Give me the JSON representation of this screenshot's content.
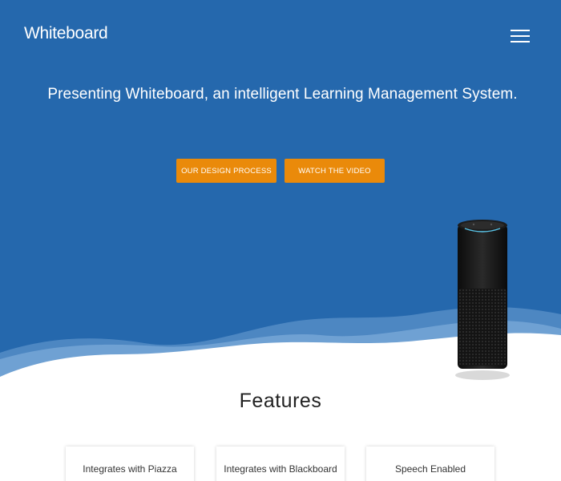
{
  "header": {
    "logo_text": "Whiteboard",
    "menu_icon": "hamburger-menu-icon"
  },
  "hero": {
    "tagline": "Presenting Whiteboard, an intelligent Learning Management System.",
    "buttons": {
      "design_process": "OUR DESIGN PROCESS",
      "watch_video": "WATCH THE VIDEO"
    },
    "device_image": "smart-speaker"
  },
  "features": {
    "title": "Features",
    "cards": [
      {
        "label": "Integrates with Piazza"
      },
      {
        "label": "Integrates with Blackboard"
      },
      {
        "label": "Speech Enabled"
      }
    ]
  },
  "colors": {
    "hero_blue": "#2568ad",
    "accent_orange": "#ea8a0a",
    "text_dark": "#222222"
  }
}
